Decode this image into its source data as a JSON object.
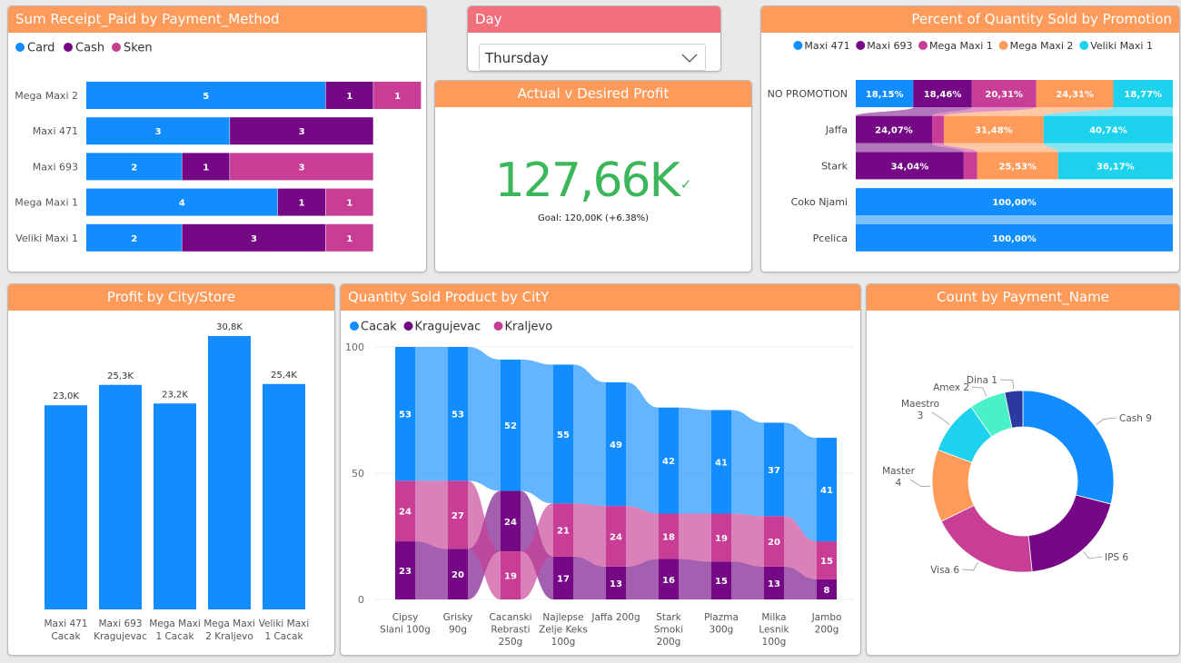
{
  "panels": {
    "receipt": {
      "title": "Sum Receipt_Paid by Payment_Method"
    },
    "day": {
      "title": "Day",
      "selected": "Thursday"
    },
    "kpi": {
      "title": "Actual v Desired Profit",
      "value": "127,66K",
      "goal": "Goal: 120,00K (+6.38%)"
    },
    "promo": {
      "title": "Percent of Quantity Sold by Promotion"
    },
    "profit": {
      "title": "Profit by City/Store"
    },
    "qty": {
      "title": "Quantity Sold Product by CitY"
    },
    "count": {
      "title": "Count by Payment_Name"
    }
  },
  "colors": {
    "blue": "#118dff",
    "purple": "#750985",
    "pink": "#c83d95",
    "orange": "#fe9a5a",
    "cyan": "#1cd2ec",
    "teal": "#4af0c8",
    "navy": "#2a3a9e",
    "title_bg": "#fe9a5a",
    "day_bg": "#f2707c",
    "kpi_green": "#3cb65a"
  },
  "icons": {
    "check": "checkmark-icon",
    "dropdown": "chevron-down-icon"
  },
  "chart_data": [
    {
      "id": "receipt",
      "type": "bar",
      "orientation": "horizontal",
      "stacked": true,
      "categories": [
        "Mega Maxi 2",
        "Maxi 471",
        "Maxi 693",
        "Mega Maxi 1",
        "Veliki Maxi 1"
      ],
      "series": [
        {
          "name": "Card",
          "values": [
            5,
            3,
            2,
            4,
            2
          ]
        },
        {
          "name": "Cash",
          "values": [
            1,
            3,
            1,
            1,
            3
          ]
        },
        {
          "name": "Sken",
          "values": [
            1,
            0,
            3,
            1,
            1
          ]
        }
      ],
      "legend": "top-left"
    },
    {
      "id": "promo",
      "type": "bar",
      "orientation": "horizontal",
      "stacked": "100%",
      "categories": [
        "NO PROMOTION",
        "Jaffa",
        "Stark",
        "Coko Njami",
        "Pcelica"
      ],
      "series": [
        {
          "name": "Maxi 471",
          "values": [
            18.15,
            0,
            0,
            100,
            100
          ]
        },
        {
          "name": "Maxi 693",
          "values": [
            18.46,
            24.07,
            34.04,
            0,
            0
          ]
        },
        {
          "name": "Mega Maxi 1",
          "values": [
            20.31,
            3.71,
            4.26,
            0,
            0
          ]
        },
        {
          "name": "Mega Maxi 2",
          "values": [
            24.31,
            31.48,
            25.53,
            0,
            0
          ]
        },
        {
          "name": "Veliki Maxi 1",
          "values": [
            18.77,
            40.74,
            36.17,
            0,
            0
          ]
        }
      ],
      "labels": [
        [
          "18,15%",
          "18,46%",
          "20,31%",
          "24,31%",
          "18,77%"
        ],
        [
          "",
          "24,07%",
          "",
          "31,48%",
          "40,74%"
        ],
        [
          "",
          "34,04%",
          "",
          "25,53%",
          "36,17%"
        ],
        [
          "100,00%",
          "",
          "",
          "",
          ""
        ],
        [
          "100,00%",
          "",
          "",
          "",
          ""
        ]
      ],
      "legend": "top-right"
    },
    {
      "id": "profit",
      "type": "bar",
      "categories": [
        "Maxi 471 Cacak",
        "Maxi 693 Kragujevac",
        "Mega Maxi 1 Cacak",
        "Mega Maxi 2 Kraljevo",
        "Veliki Maxi 1 Cacak"
      ],
      "values": [
        23.0,
        25.3,
        23.2,
        30.8,
        25.4
      ],
      "value_labels": [
        "23,0K",
        "25,3K",
        "23,2K",
        "30,8K",
        "25,4K"
      ]
    },
    {
      "id": "qty",
      "type": "bar",
      "stacked": true,
      "subtype": "ribbon",
      "categories": [
        "Cipsy Slani 100g",
        "Grisky 90g",
        "Cacanski Rebrasti 250g",
        "Najlepse Zelje Keks 100g",
        "Jaffa 200g",
        "Stark Smoki 200g",
        "Plazma 300g",
        "Milka Lesnik 100g",
        "Jambo 200g"
      ],
      "series": [
        {
          "name": "Cacak",
          "values": [
            53,
            53,
            52,
            55,
            49,
            42,
            41,
            37,
            41
          ]
        },
        {
          "name": "Kragujevac",
          "values": [
            23,
            20,
            24,
            17,
            13,
            16,
            15,
            13,
            8
          ]
        },
        {
          "name": "Kraljevo",
          "values": [
            24,
            27,
            19,
            21,
            24,
            18,
            19,
            20,
            15
          ]
        }
      ],
      "ylim": [
        0,
        100
      ],
      "yticks": [
        "0",
        "50",
        "100"
      ],
      "legend": "top-left"
    },
    {
      "id": "count",
      "type": "pie",
      "donut": true,
      "slices": [
        {
          "name": "Cash",
          "value": 9,
          "label": "Cash 9"
        },
        {
          "name": "IPS",
          "value": 6,
          "label": "IPS 6"
        },
        {
          "name": "Visa",
          "value": 6,
          "label": "Visa 6"
        },
        {
          "name": "Master",
          "value": 4,
          "label": "Master 4"
        },
        {
          "name": "Maestro",
          "value": 3,
          "label": "Maestro 3"
        },
        {
          "name": "Amex",
          "value": 2,
          "label": "Amex 2"
        },
        {
          "name": "Dina",
          "value": 1,
          "label": "Dina 1"
        }
      ]
    }
  ]
}
